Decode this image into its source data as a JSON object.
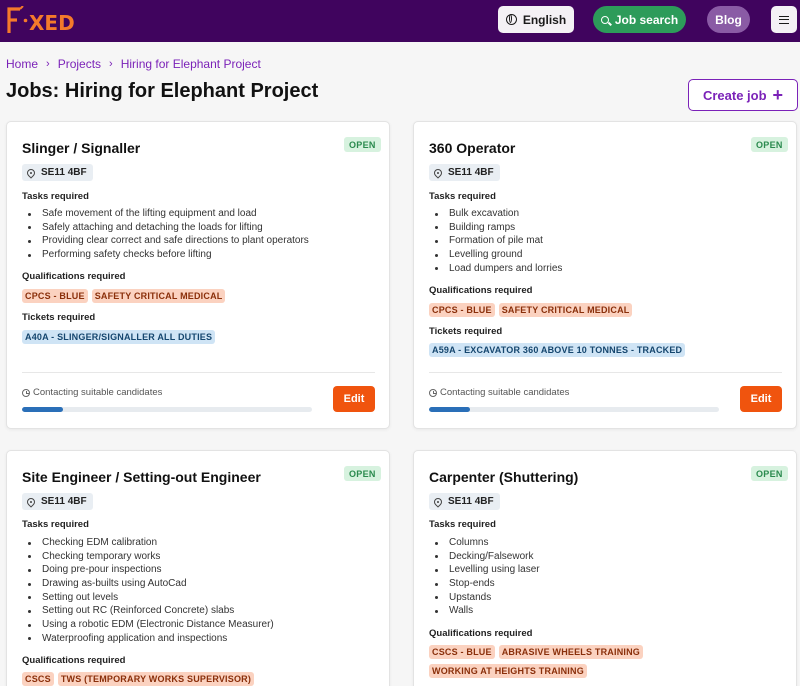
{
  "header": {
    "logo_text": "F·XED",
    "language_label": "English",
    "job_search_label": "Job search",
    "blog_label": "Blog",
    "brand_color": "#40045e"
  },
  "breadcrumb": [
    "Home",
    "Projects",
    "Hiring for Elephant Project"
  ],
  "page_title": "Jobs: Hiring for Elephant Project",
  "create_job_label": "Create job",
  "labels": {
    "tasks": "Tasks required",
    "qualifications": "Qualifications required",
    "tickets": "Tickets required",
    "edit": "Edit"
  },
  "jobs": [
    {
      "title": "Slinger / Signaller",
      "status": "OPEN",
      "location": "SE11 4BF",
      "tasks": [
        "Safe movement of the lifting equipment and load",
        "Safely attaching and detaching the loads for lifting",
        "Providing clear correct and safe directions to plant operators",
        "Performing safety checks before lifting"
      ],
      "qualifications": [
        "CPCS - BLUE",
        "SAFETY CRITICAL MEDICAL"
      ],
      "tickets": [
        "A40A - SLINGER/SIGNALLER ALL DUTIES"
      ],
      "contact_status": "Contacting suitable candidates",
      "progress": 0.14
    },
    {
      "title": "360 Operator",
      "status": "OPEN",
      "location": "SE11 4BF",
      "tasks": [
        "Bulk excavation",
        "Building ramps",
        "Formation of pile mat",
        "Levelling ground",
        "Load dumpers and lorries"
      ],
      "qualifications": [
        "CPCS - BLUE",
        "SAFETY CRITICAL MEDICAL"
      ],
      "tickets": [
        "A59A - EXCAVATOR 360 ABOVE 10 TONNES - TRACKED"
      ],
      "contact_status": "Contacting suitable candidates",
      "progress": 0.14
    },
    {
      "title": "Site Engineer / Setting-out Engineer",
      "status": "OPEN",
      "location": "SE11 4BF",
      "tasks": [
        "Checking EDM calibration",
        "Checking temporary works",
        "Doing pre-pour inspections",
        "Drawing as-builts using AutoCad",
        "Setting out levels",
        "Setting out RC (Reinforced Concrete) slabs",
        "Using a robotic EDM (Electronic Distance Measurer)",
        "Waterproofing application and inspections"
      ],
      "qualifications": [
        "CSCS",
        "TWS (TEMPORARY WORKS SUPERVISOR)"
      ]
    },
    {
      "title": "Carpenter (Shuttering)",
      "status": "OPEN",
      "location": "SE11 4BF",
      "tasks": [
        "Columns",
        "Decking/Falsework",
        "Levelling using laser",
        "Stop-ends",
        "Upstands",
        "Walls"
      ],
      "qualifications": [
        "CSCS - BLUE",
        "ABRASIVE WHEELS TRAINING",
        "WORKING AT HEIGHTS TRAINING"
      ]
    }
  ]
}
